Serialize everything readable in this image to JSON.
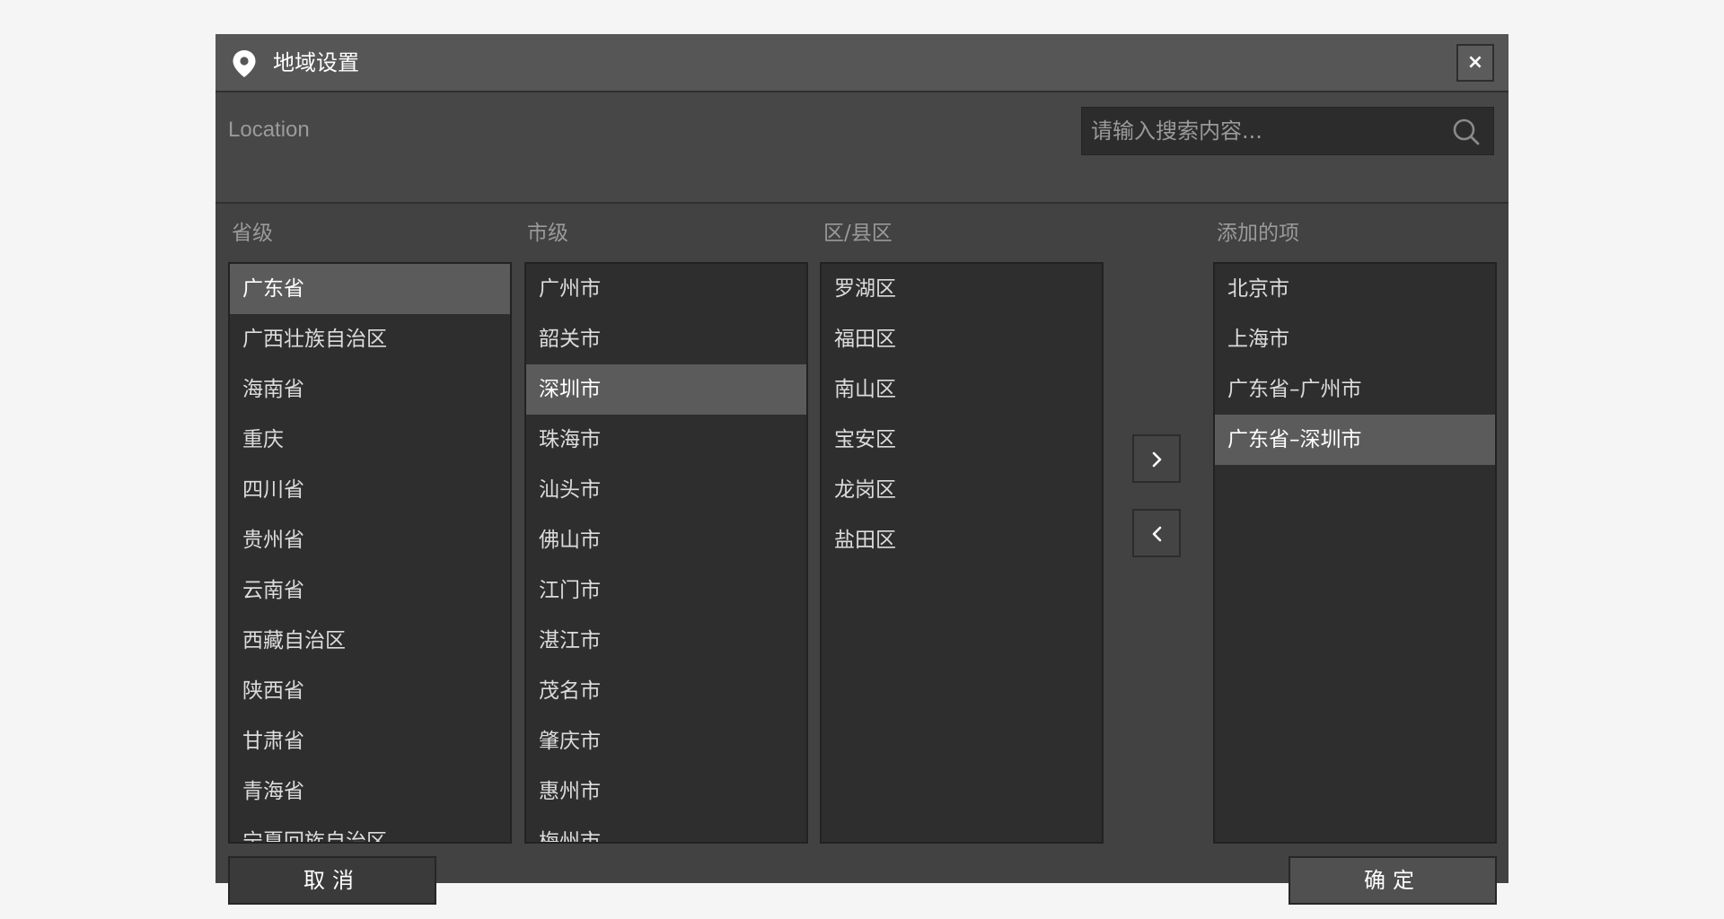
{
  "window": {
    "title": "地域设置",
    "close_label": "×"
  },
  "toolbar": {
    "location_label": "Location",
    "search_placeholder": "请输入搜索内容..."
  },
  "columns": {
    "province_header": "省级",
    "city_header": "市级",
    "district_header": "区/县区",
    "added_header": "添加的项"
  },
  "provinces": [
    {
      "label": "广东省",
      "selected": true
    },
    {
      "label": "广西壮族自治区",
      "selected": false
    },
    {
      "label": "海南省",
      "selected": false
    },
    {
      "label": "重庆",
      "selected": false
    },
    {
      "label": "四川省",
      "selected": false
    },
    {
      "label": "贵州省",
      "selected": false
    },
    {
      "label": "云南省",
      "selected": false
    },
    {
      "label": "西藏自治区",
      "selected": false
    },
    {
      "label": "陕西省",
      "selected": false
    },
    {
      "label": "甘肃省",
      "selected": false
    },
    {
      "label": "青海省",
      "selected": false
    },
    {
      "label": "宁夏回族自治区",
      "selected": false
    }
  ],
  "cities": [
    {
      "label": "广州市",
      "selected": false
    },
    {
      "label": "韶关市",
      "selected": false
    },
    {
      "label": "深圳市",
      "selected": true
    },
    {
      "label": "珠海市",
      "selected": false
    },
    {
      "label": "汕头市",
      "selected": false
    },
    {
      "label": "佛山市",
      "selected": false
    },
    {
      "label": "江门市",
      "selected": false
    },
    {
      "label": "湛江市",
      "selected": false
    },
    {
      "label": "茂名市",
      "selected": false
    },
    {
      "label": "肇庆市",
      "selected": false
    },
    {
      "label": "惠州市",
      "selected": false
    },
    {
      "label": "梅州市",
      "selected": false
    }
  ],
  "districts": [
    {
      "label": "罗湖区",
      "selected": false
    },
    {
      "label": "福田区",
      "selected": false
    },
    {
      "label": "南山区",
      "selected": false
    },
    {
      "label": "宝安区",
      "selected": false
    },
    {
      "label": "龙岗区",
      "selected": false
    },
    {
      "label": "盐田区",
      "selected": false
    }
  ],
  "added": [
    {
      "label": "北京市",
      "selected": false
    },
    {
      "label": "上海市",
      "selected": false
    },
    {
      "label": "广东省–广州市",
      "selected": false
    },
    {
      "label": "广东省–深圳市",
      "selected": true
    }
  ],
  "footer": {
    "cancel_label": "取消",
    "confirm_label": "确定"
  },
  "icons": {
    "title_icon": "location-pin-icon",
    "search_icon": "search-icon",
    "add_arrow": "chevron-right-icon",
    "remove_arrow": "chevron-left-icon"
  }
}
